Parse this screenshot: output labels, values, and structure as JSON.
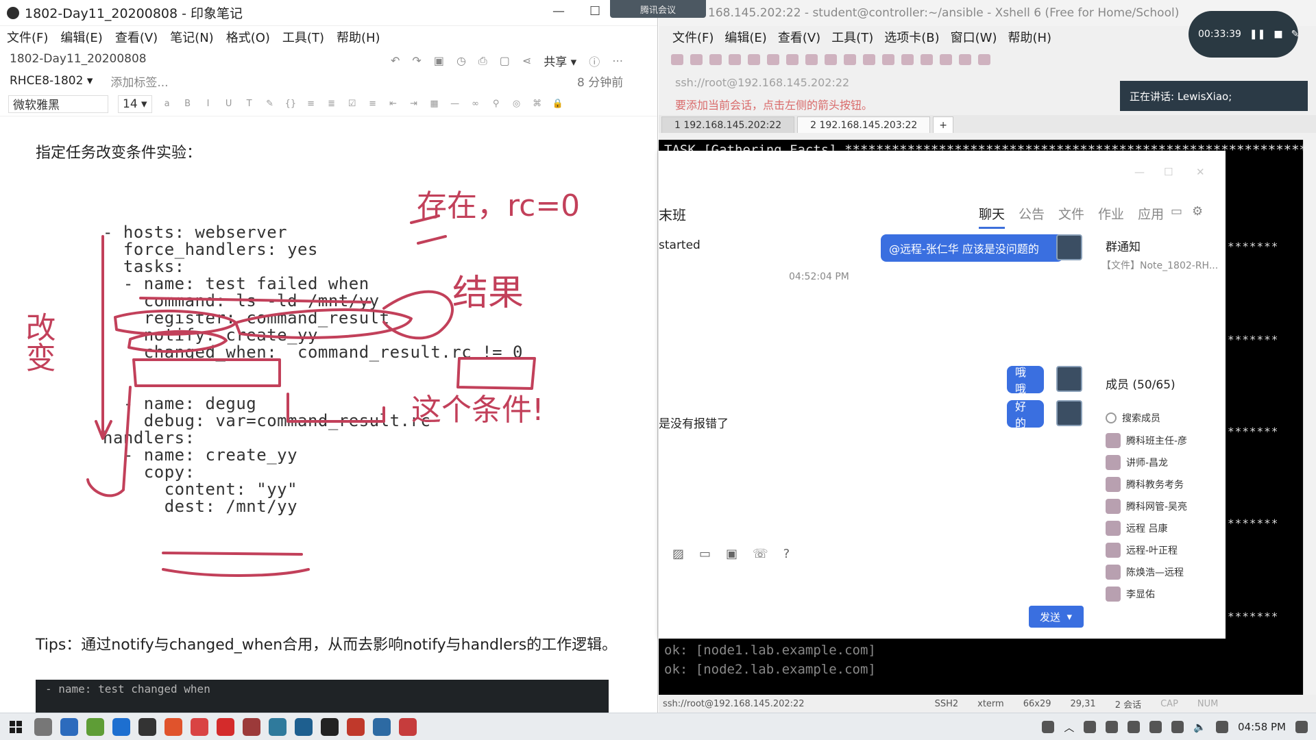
{
  "left_window": {
    "title": "1802-Day11_20200808 - 印象笔记",
    "menu": [
      "文件(F)",
      "编辑(E)",
      "查看(V)",
      "笔记(N)",
      "格式(O)",
      "工具(T)",
      "帮助(H)"
    ],
    "note_name": "1802-Day11_20200808",
    "share_label": "共享",
    "notebook": "RHCE8-1802",
    "add_tag": "添加标签...",
    "last_edit": "8 分钟前",
    "font_name": "微软雅黑",
    "font_size": "14",
    "heading": "指定任务改变条件实验：",
    "code_lines": [
      "- hosts: webserver",
      "  force_handlers: yes",
      "  tasks:",
      "  - name: test failed when",
      "    command: ls -ld /mnt/yy",
      "    register: command_result",
      "    notify: create_yy",
      "    changed_when:  command_result.rc != 0",
      "  - name: degug",
      "    debug: var=command_result.rc",
      "handlers:",
      "  - name: create_yy",
      "    copy:",
      "      content: \"yy\"",
      "      dest: /mnt/yy"
    ],
    "tips": "Tips：通过notify与changed_when合用，从而去影响notify与handlers的工作逻辑。",
    "dark_block_text": "- name: test changed when"
  },
  "handwriting": {
    "top": "存在，rc=0",
    "result": "结果",
    "change": "改变",
    "this_condition": "这个条件!"
  },
  "right_window": {
    "title": "168.145.202:22 - student@controller:~/ansible - Xshell 6 (Free for Home/School)",
    "menu": [
      "文件(F)",
      "编辑(E)",
      "查看(V)",
      "工具(T)",
      "选项卡(B)",
      "窗口(W)",
      "帮助(H)"
    ],
    "address": "ssh://root@192.168.145.202:22",
    "hint": "要添加当前会话，点击左侧的箭头按钮。",
    "tabs": [
      "1 192.168.145.202:22",
      "2 192.168.145.203:22"
    ],
    "terminal_lines": {
      "task": "TASK [Gathering Facts] ****************************************************************",
      "ok1": "ok: [node1.lab.example.com]",
      "ok2": "ok: [node2.lab.example.com]",
      "stars": "*******"
    },
    "status": {
      "conn": "ssh://root@192.168.145.202:22",
      "proto": "SSH2",
      "term": "xterm",
      "size": "66x29",
      "pos": "29,31",
      "sessions": "2 会话",
      "cap": "CAP",
      "num": "NUM"
    }
  },
  "meeting": {
    "app_tab": "腾讯会议",
    "timer": "00:33:39",
    "speaking": "正在讲话: LewisXiao;"
  },
  "chat": {
    "group": "末班",
    "tabs": [
      "聊天",
      "公告",
      "文件",
      "作业",
      "应用"
    ],
    "started": "started",
    "timestamp": "04:52:04 PM",
    "bubble1": "@远程-张仁华 应该是没问题的",
    "msg2": "是没有报错了",
    "bubble2": "哦哦",
    "bubble3": "好的",
    "send": "发送",
    "notice_title": "群通知",
    "notice_file": "【文件】Note_1802-RH...",
    "members_title": "成员 (50/65)",
    "members": [
      "搜索成员",
      "腾科班主任-彦",
      "讲师-昌龙",
      "腾科教务考务",
      "腾科网管-吴亮",
      "远程 吕康",
      "远程-叶正程",
      "陈焕浩—远程",
      "李显佑"
    ]
  },
  "taskbar": {
    "clock": "04:58 PM"
  },
  "colors": {
    "ink": "#c2405a",
    "accent_blue": "#3a6fe0",
    "terminal_bg": "#000000"
  }
}
